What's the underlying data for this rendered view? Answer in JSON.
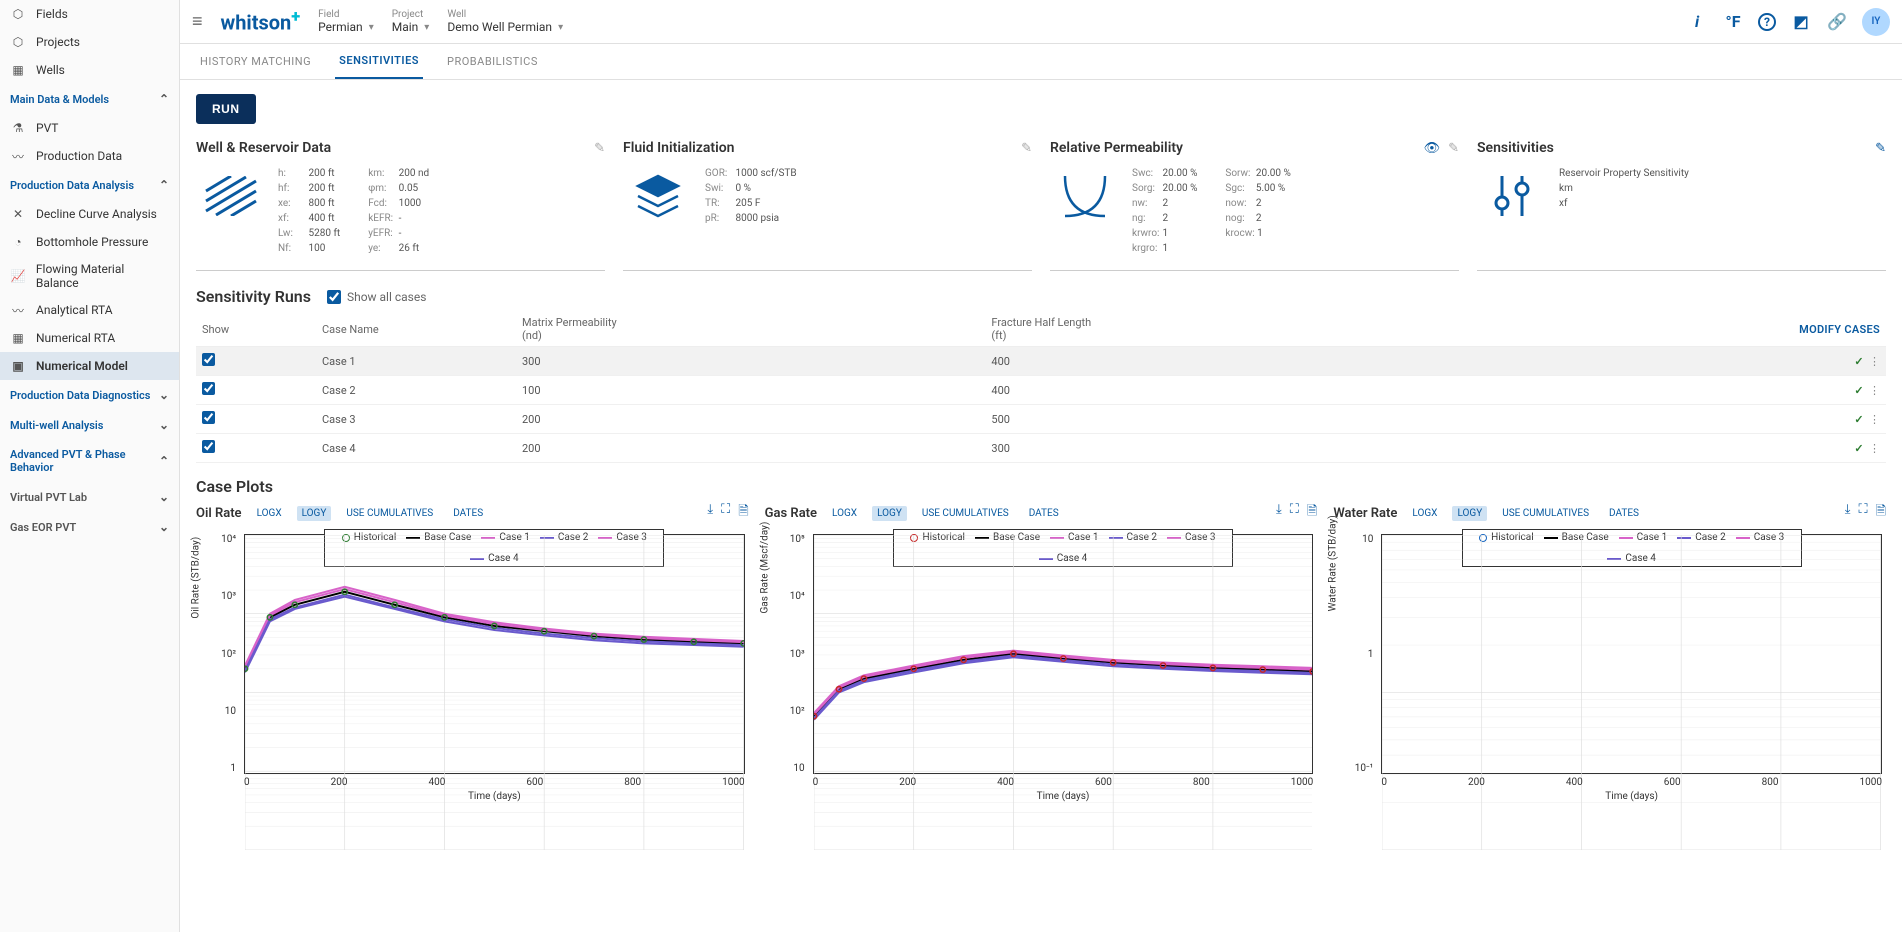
{
  "brand": "whitson",
  "brand_plus": "+",
  "selectors": {
    "field": {
      "label": "Field",
      "value": "Permian"
    },
    "project": {
      "label": "Project",
      "value": "Main"
    },
    "well": {
      "label": "Well",
      "value": "Demo Well Permian"
    }
  },
  "topIcons": {
    "info": "i",
    "temp": "°F",
    "help": "?",
    "link": "⎘",
    "share": "🔗"
  },
  "avatar": "IY",
  "sidebar": {
    "top": [
      {
        "icon": "⬡",
        "label": "Fields"
      },
      {
        "icon": "⬡",
        "label": "Projects"
      },
      {
        "icon": "▦",
        "label": "Wells"
      }
    ],
    "sections": [
      {
        "title": "Main Data & Models",
        "open": true,
        "items": [
          {
            "icon": "⚗",
            "label": "PVT"
          },
          {
            "icon": "〰",
            "label": "Production Data"
          }
        ]
      },
      {
        "title": "Production Data Analysis",
        "open": true,
        "items": [
          {
            "icon": "✕",
            "label": "Decline Curve Analysis"
          },
          {
            "icon": "◔",
            "label": "Bottomhole Pressure"
          },
          {
            "icon": "📈",
            "label": "Flowing Material Balance"
          },
          {
            "icon": "〰",
            "label": "Analytical RTA"
          },
          {
            "icon": "▦",
            "label": "Numerical RTA"
          },
          {
            "icon": "▣",
            "label": "Numerical Model",
            "active": true
          }
        ]
      },
      {
        "title": "Production Data Diagnostics",
        "open": false
      },
      {
        "title": "Multi-well Analysis",
        "open": false
      },
      {
        "title": "Advanced PVT & Phase Behavior",
        "open": true
      },
      {
        "title": "Virtual PVT Lab",
        "open": false,
        "plain": true
      },
      {
        "title": "Gas EOR PVT",
        "open": false,
        "plain": true
      }
    ]
  },
  "tabs": [
    {
      "label": "HISTORY MATCHING"
    },
    {
      "label": "SENSITIVITIES",
      "active": true
    },
    {
      "label": "PROBABILISTICS"
    }
  ],
  "run": "RUN",
  "cards": {
    "well": {
      "title": "Well & Reservoir Data",
      "rows1": [
        {
          "k": "h:",
          "v": "200 ft"
        },
        {
          "k": "hf:",
          "v": "200 ft"
        },
        {
          "k": "xe:",
          "v": "800 ft"
        },
        {
          "k": "xf:",
          "v": "400 ft"
        },
        {
          "k": "Lw:",
          "v": "5280 ft"
        },
        {
          "k": "Nf:",
          "v": "100"
        }
      ],
      "rows2": [
        {
          "k": "km:",
          "v": "200 nd"
        },
        {
          "k": "φm:",
          "v": "0.05"
        },
        {
          "k": "Fcd:",
          "v": "1000"
        },
        {
          "k": "kEFR:",
          "v": "-"
        },
        {
          "k": "yEFR:",
          "v": "-"
        },
        {
          "k": "ye:",
          "v": "26 ft"
        }
      ]
    },
    "fluid": {
      "title": "Fluid Initialization",
      "rows": [
        {
          "k": "GOR:",
          "v": "1000 scf/STB"
        },
        {
          "k": "Swi:",
          "v": "0 %"
        },
        {
          "k": "TR:",
          "v": "205 F"
        },
        {
          "k": "pR:",
          "v": "8000 psia"
        }
      ]
    },
    "relperm": {
      "title": "Relative Permeability",
      "rows1": [
        {
          "k": "Swc:",
          "v": "20.00 %"
        },
        {
          "k": "Sorg:",
          "v": "20.00 %"
        },
        {
          "k": "nw:",
          "v": "2"
        },
        {
          "k": "ng:",
          "v": "2"
        },
        {
          "k": "krwro:",
          "v": "1"
        },
        {
          "k": "krgro:",
          "v": "1"
        }
      ],
      "rows2": [
        {
          "k": "Sorw:",
          "v": "20.00 %"
        },
        {
          "k": "Sgc:",
          "v": "5.00 %"
        },
        {
          "k": "now:",
          "v": "2"
        },
        {
          "k": "nog:",
          "v": "2"
        },
        {
          "k": "krocw:",
          "v": "1"
        }
      ]
    },
    "sens": {
      "title": "Sensitivities",
      "type": "Reservoir Property Sensitivity",
      "params": "km\nxf"
    }
  },
  "runs": {
    "title": "Sensitivity Runs",
    "showAll": "Show all cases",
    "modify": "MODIFY CASES",
    "headers": [
      "Show",
      "Case Name",
      "Matrix Permeability\n(nd)",
      "Fracture Half Length\n(ft)"
    ],
    "rows": [
      {
        "show": true,
        "name": "Case 1",
        "perm": "300",
        "xf": "400",
        "selected": true
      },
      {
        "show": true,
        "name": "Case 2",
        "perm": "100",
        "xf": "400"
      },
      {
        "show": true,
        "name": "Case 3",
        "perm": "200",
        "xf": "500"
      },
      {
        "show": true,
        "name": "Case 4",
        "perm": "200",
        "xf": "300"
      }
    ]
  },
  "plots": {
    "title": "Case Plots",
    "controls": [
      "LOGX",
      "LOGY",
      "USE CUMULATIVES",
      "DATES"
    ],
    "legend": [
      "Historical",
      "Base Case",
      "Case 1",
      "Case 2",
      "Case 3",
      "Case 4"
    ],
    "colors": {
      "Historical": "#2e7d32",
      "Base Case": "#000",
      "Case 1": "#d863c9",
      "Case 2": "#6a5acd",
      "Case 3": "#d863c9",
      "Case 4": "#6a5acd"
    },
    "historicalColors": {
      "Oil Rate": "#2e7d32",
      "Gas Rate": "#c62828",
      "Water Rate": "#1565c0"
    },
    "items": [
      {
        "title": "Oil Rate",
        "ylabel": "Oil Rate (STB/day)",
        "yticks": [
          "10⁴",
          "10³",
          "10²",
          "10",
          "1"
        ],
        "unit": "STB/day"
      },
      {
        "title": "Gas Rate",
        "ylabel": "Gas Rate (Mscf/day)",
        "yticks": [
          "10⁵",
          "10⁴",
          "10³",
          "10²",
          "10"
        ],
        "unit": "Mscf/day"
      },
      {
        "title": "Water Rate",
        "ylabel": "Water Rate (STB/day)",
        "yticks": [
          "10",
          "1",
          "10⁻¹"
        ],
        "unit": "STB/day",
        "empty": true
      }
    ],
    "xticks": [
      "0",
      "200",
      "400",
      "600",
      "800",
      "1000"
    ],
    "xlabel": "Time (days)"
  },
  "chart_data": [
    {
      "type": "line",
      "title": "Oil Rate",
      "xlabel": "Time (days)",
      "ylabel": "Oil Rate (STB/day)",
      "xlim": [
        0,
        1000
      ],
      "ylim": [
        1,
        10000
      ],
      "yscale": "log",
      "x": [
        0,
        50,
        100,
        200,
        300,
        400,
        500,
        600,
        700,
        800,
        900,
        1000
      ],
      "series": [
        {
          "name": "Historical",
          "style": "markers",
          "color": "#2e7d32"
        },
        {
          "name": "Base Case",
          "color": "#000000",
          "values": [
            200,
            900,
            1300,
            1900,
            1300,
            900,
            700,
            600,
            520,
            470,
            440,
            420
          ]
        },
        {
          "name": "Case 1",
          "color": "#d863c9",
          "values": [
            220,
            1000,
            1500,
            2200,
            1500,
            1000,
            780,
            650,
            560,
            510,
            480,
            450
          ]
        },
        {
          "name": "Case 2",
          "color": "#6a5acd",
          "values": [
            180,
            800,
            1150,
            1650,
            1150,
            800,
            620,
            530,
            460,
            420,
            400,
            380
          ]
        },
        {
          "name": "Case 3",
          "color": "#d863c9",
          "values": [
            210,
            950,
            1400,
            2050,
            1400,
            950,
            740,
            620,
            540,
            490,
            460,
            435
          ]
        },
        {
          "name": "Case 4",
          "color": "#6a5acd",
          "values": [
            190,
            850,
            1200,
            1750,
            1200,
            850,
            660,
            560,
            490,
            445,
            420,
            400
          ]
        }
      ]
    },
    {
      "type": "line",
      "title": "Gas Rate",
      "xlabel": "Time (days)",
      "ylabel": "Gas Rate (Mscf/day)",
      "xlim": [
        0,
        1000
      ],
      "ylim": [
        10,
        100000
      ],
      "yscale": "log",
      "x": [
        0,
        50,
        100,
        200,
        300,
        400,
        500,
        600,
        700,
        800,
        900,
        1000
      ],
      "series": [
        {
          "name": "Historical",
          "style": "markers",
          "color": "#c62828"
        },
        {
          "name": "Base Case",
          "color": "#000000",
          "values": [
            500,
            1100,
            1500,
            2000,
            2600,
            3100,
            2700,
            2400,
            2200,
            2050,
            1950,
            1850
          ]
        },
        {
          "name": "Case 1",
          "color": "#d863c9",
          "values": [
            550,
            1200,
            1650,
            2200,
            2900,
            3400,
            2950,
            2600,
            2400,
            2250,
            2150,
            2050
          ]
        },
        {
          "name": "Case 2",
          "color": "#6a5acd",
          "values": [
            450,
            1000,
            1350,
            1800,
            2350,
            2800,
            2450,
            2150,
            2000,
            1870,
            1780,
            1700
          ]
        },
        {
          "name": "Case 3",
          "color": "#d863c9",
          "values": [
            525,
            1150,
            1575,
            2100,
            2750,
            3250,
            2825,
            2500,
            2300,
            2150,
            2050,
            1950
          ]
        },
        {
          "name": "Case 4",
          "color": "#6a5acd",
          "values": [
            475,
            1050,
            1425,
            1900,
            2475,
            2950,
            2575,
            2275,
            2100,
            1960,
            1865,
            1775
          ]
        }
      ]
    },
    {
      "type": "line",
      "title": "Water Rate",
      "xlabel": "Time (days)",
      "ylabel": "Water Rate (STB/day)",
      "xlim": [
        0,
        1000
      ],
      "ylim": [
        0.1,
        10
      ],
      "yscale": "log",
      "x": [],
      "series": [
        {
          "name": "Historical",
          "style": "markers",
          "color": "#1565c0",
          "values": []
        },
        {
          "name": "Base Case",
          "color": "#000000",
          "values": []
        },
        {
          "name": "Case 1",
          "color": "#d863c9",
          "values": []
        },
        {
          "name": "Case 2",
          "color": "#6a5acd",
          "values": []
        },
        {
          "name": "Case 3",
          "color": "#d863c9",
          "values": []
        },
        {
          "name": "Case 4",
          "color": "#6a5acd",
          "values": []
        }
      ]
    }
  ]
}
